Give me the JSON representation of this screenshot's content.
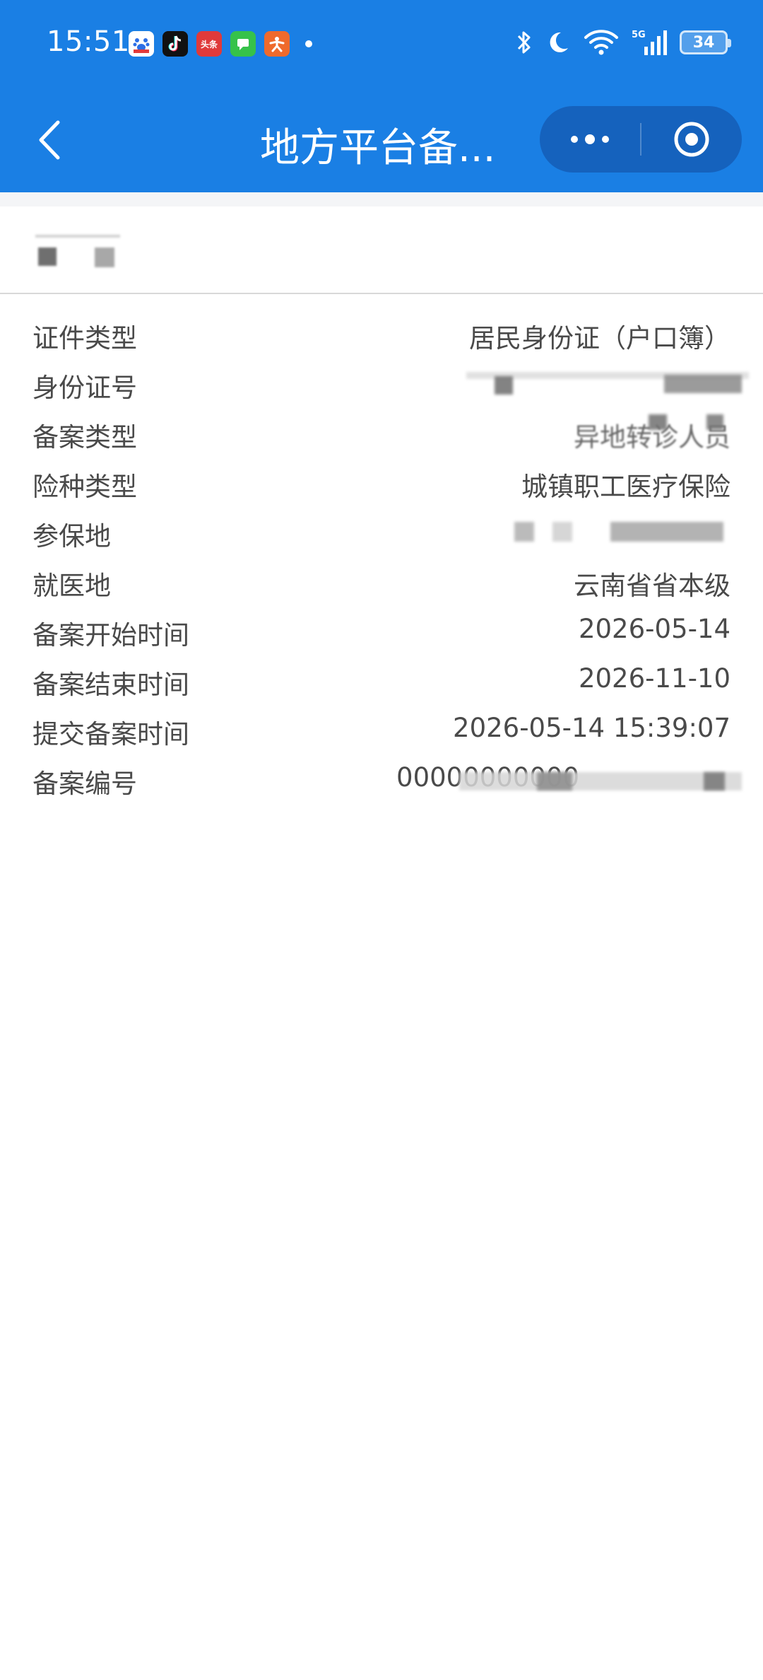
{
  "status_bar": {
    "time": "15:51",
    "battery": "34",
    "apps": [
      "baidu-icon",
      "tiktok-icon",
      "toutiao-icon",
      "messages-icon",
      "app-icon"
    ],
    "toutiao_label": "头条"
  },
  "nav": {
    "title": "地方平台备...",
    "back_icon": "chevron-left-icon",
    "more_icon": "more-dots-icon",
    "close_icon": "target-close-icon"
  },
  "details": [
    {
      "label": "证件类型",
      "value": "居民身份证（户口簿）"
    },
    {
      "label": "身份证号",
      "value": ""
    },
    {
      "label": "备案类型",
      "value": "异地转诊人员"
    },
    {
      "label": "险种类型",
      "value": "城镇职工医疗保险"
    },
    {
      "label": "参保地",
      "value": ""
    },
    {
      "label": "就医地",
      "value": "云南省省本级"
    },
    {
      "label": "备案开始时间",
      "value": "2026-05-14"
    },
    {
      "label": "备案结束时间",
      "value": "2026-11-10"
    },
    {
      "label": "提交备案时间",
      "value": "2026-05-14 15:39:07"
    },
    {
      "label": "备案编号",
      "value": "00000000000"
    }
  ],
  "colors": {
    "header_bg": "#1a7fe4",
    "capsule_bg": "#1562bd",
    "text": "#4a4a4a"
  }
}
